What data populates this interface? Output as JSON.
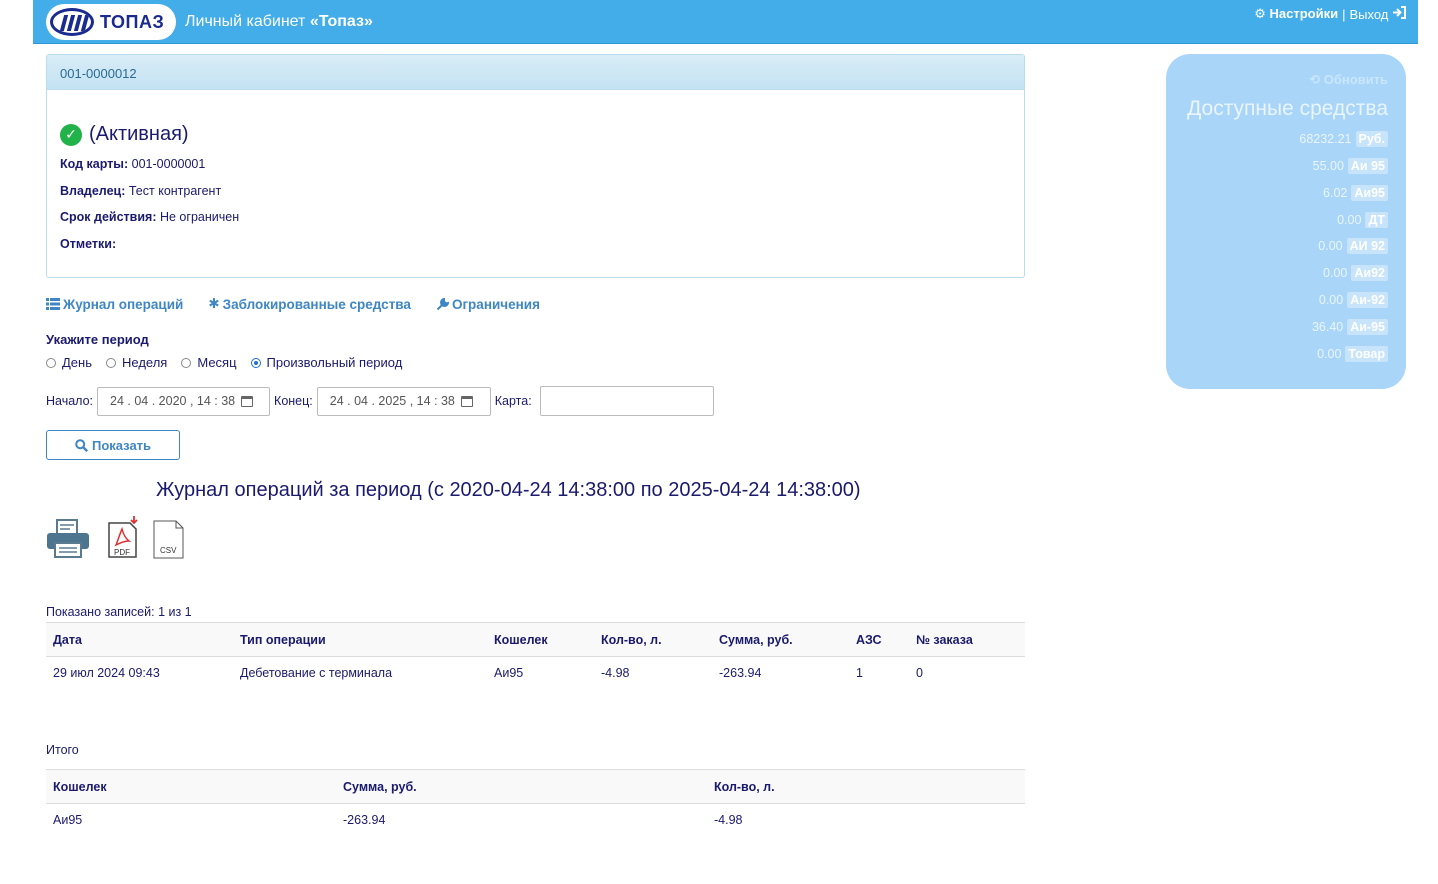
{
  "header": {
    "logo_text": "ТОПАЗ",
    "app_title_prefix": "Личный кабинет ",
    "app_title_bold": "«Топаз»",
    "settings_label": "Настройки",
    "separator": "|",
    "logout_label": "Выход"
  },
  "card": {
    "number": "001-0000012",
    "status": "(Активная)",
    "code_label": "Код карты:",
    "code_value": "001-0000001",
    "owner_label": "Владелец:",
    "owner_value": "Тест контрагент",
    "validity_label": "Срок действия:",
    "validity_value": "Не ограничен",
    "marks_label": "Отметки:"
  },
  "tabs": [
    "Журнал операций",
    "Заблокированные средства",
    "Ограничения"
  ],
  "period": {
    "label": "Укажите период",
    "options": [
      "День",
      "Неделя",
      "Месяц",
      "Произвольный период"
    ],
    "selected": "Произвольный период"
  },
  "filters": {
    "start_label": "Начало:",
    "start_value": "24 . 04 . 2020 ,  14 : 38",
    "end_label": "Конец:",
    "end_value": "24 . 04 . 2025 ,  14 : 38",
    "card_label": "Карта:",
    "card_value": ""
  },
  "show_button": "Показать",
  "journal_title": "Журнал операций за период (с 2020-04-24 14:38:00 по 2025-04-24 14:38:00)",
  "export": {
    "pdf_label": "PDF",
    "csv_label": "CSV"
  },
  "operations": {
    "shown": "Показано записей: 1 из 1",
    "headers": [
      "Дата",
      "Тип операции",
      "Кошелек",
      "Кол-во, л.",
      "Сумма, руб.",
      "АЗС",
      "№ заказа"
    ],
    "rows": [
      [
        "29 июл 2024 09:43",
        "Дебетование с терминала",
        "Аи95",
        "-4.98",
        "-263.94",
        "1",
        "0"
      ]
    ]
  },
  "totals": {
    "label": "Итого",
    "headers": [
      "Кошелек",
      "Сумма, руб.",
      "Кол-во, л."
    ],
    "rows": [
      [
        "Аи95",
        "-263.94",
        "-4.98"
      ]
    ]
  },
  "funds": {
    "refresh_label": "Обновить",
    "title": "Доступные средства",
    "items": [
      {
        "value": "68232.21",
        "unit": "Руб."
      },
      {
        "value": "55.00",
        "unit": "Аи 95"
      },
      {
        "value": "6.02",
        "unit": "Аи95"
      },
      {
        "value": "0.00",
        "unit": "ДТ"
      },
      {
        "value": "0.00",
        "unit": "АИ 92"
      },
      {
        "value": "0.00",
        "unit": "Аи92"
      },
      {
        "value": "0.00",
        "unit": "Аи-92"
      },
      {
        "value": "36.40",
        "unit": "Аи-95"
      },
      {
        "value": "0.00",
        "unit": "Товар"
      }
    ]
  },
  "colors": {
    "header_bg": "#42ade8",
    "link": "#3f86c4",
    "text": "#1a1a6e",
    "status_ok": "#21b24a",
    "funds_bg": "#a8d5f8"
  }
}
